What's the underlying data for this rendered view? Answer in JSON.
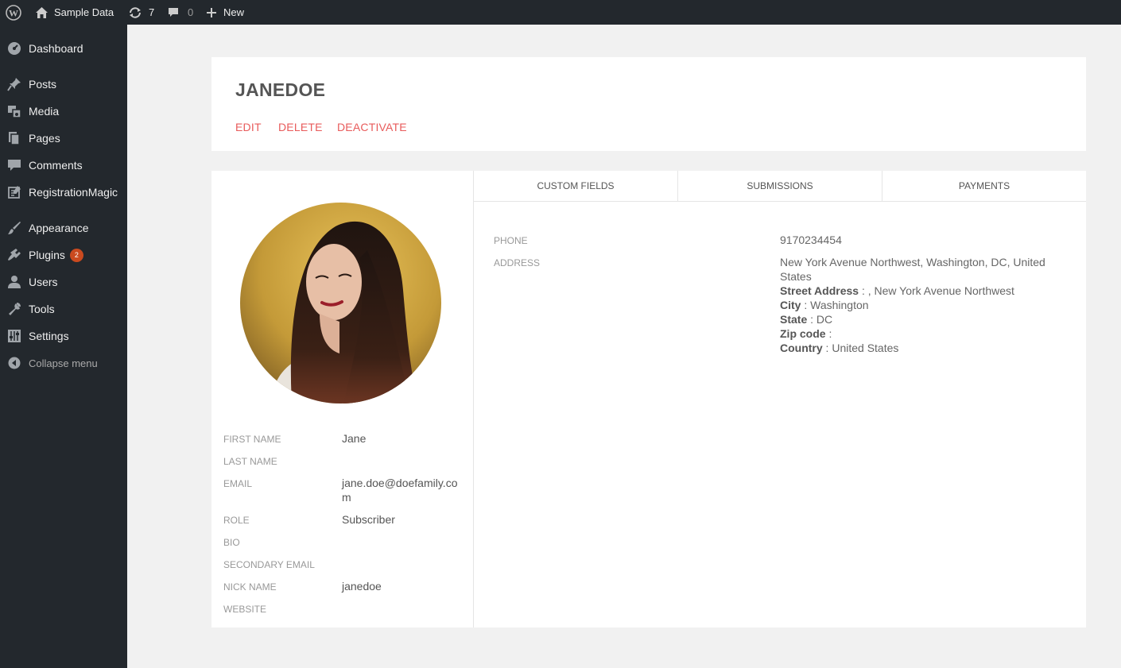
{
  "adminbar": {
    "site_name": "Sample Data",
    "updates_count": "7",
    "comments_count": "0",
    "new_label": "New"
  },
  "sidebar": {
    "items": [
      {
        "label": "Dashboard",
        "icon": "dashboard-icon"
      },
      {
        "label": "Posts",
        "icon": "pushpin-icon"
      },
      {
        "label": "Media",
        "icon": "media-icon"
      },
      {
        "label": "Pages",
        "icon": "pages-icon"
      },
      {
        "label": "Comments",
        "icon": "comment-icon"
      },
      {
        "label": "RegistrationMagic",
        "icon": "form-icon"
      },
      {
        "label": "Appearance",
        "icon": "brush-icon"
      },
      {
        "label": "Plugins",
        "icon": "plug-icon",
        "badge": "2"
      },
      {
        "label": "Users",
        "icon": "user-icon"
      },
      {
        "label": "Tools",
        "icon": "wrench-icon"
      },
      {
        "label": "Settings",
        "icon": "settings-icon"
      }
    ],
    "collapse_label": "Collapse menu"
  },
  "header": {
    "title": "JANEDOE",
    "actions": [
      "EDIT",
      "DELETE",
      "DEACTIVATE"
    ]
  },
  "profile": {
    "fields": [
      {
        "label": "FIRST NAME",
        "value": "Jane"
      },
      {
        "label": "LAST NAME",
        "value": ""
      },
      {
        "label": "EMAIL",
        "value": "jane.doe@doefamily.com"
      },
      {
        "label": "ROLE",
        "value": "Subscriber"
      },
      {
        "label": "BIO",
        "value": ""
      },
      {
        "label": "SECONDARY EMAIL",
        "value": ""
      },
      {
        "label": "NICK NAME",
        "value": "janedoe"
      },
      {
        "label": "WEBSITE",
        "value": ""
      }
    ]
  },
  "tabs": [
    "CUSTOM FIELDS",
    "SUBMISSIONS",
    "PAYMENTS"
  ],
  "custom_fields": {
    "phone_label": "PHONE",
    "phone_value": "9170234454",
    "address_label": "ADDRESS",
    "address_full": "New York Avenue Northwest, Washington, DC, United States",
    "address_parts": [
      {
        "key": "Street Address",
        "value": " : , New York Avenue Northwest"
      },
      {
        "key": "City",
        "value": " : Washington"
      },
      {
        "key": "State",
        "value": " : DC"
      },
      {
        "key": "Zip code",
        "value": " :"
      },
      {
        "key": "Country",
        "value": " : United States"
      }
    ]
  },
  "colors": {
    "adminbar_bg": "#23282d",
    "action_link": "#e85b5b",
    "badge": "#ca4a1f"
  }
}
